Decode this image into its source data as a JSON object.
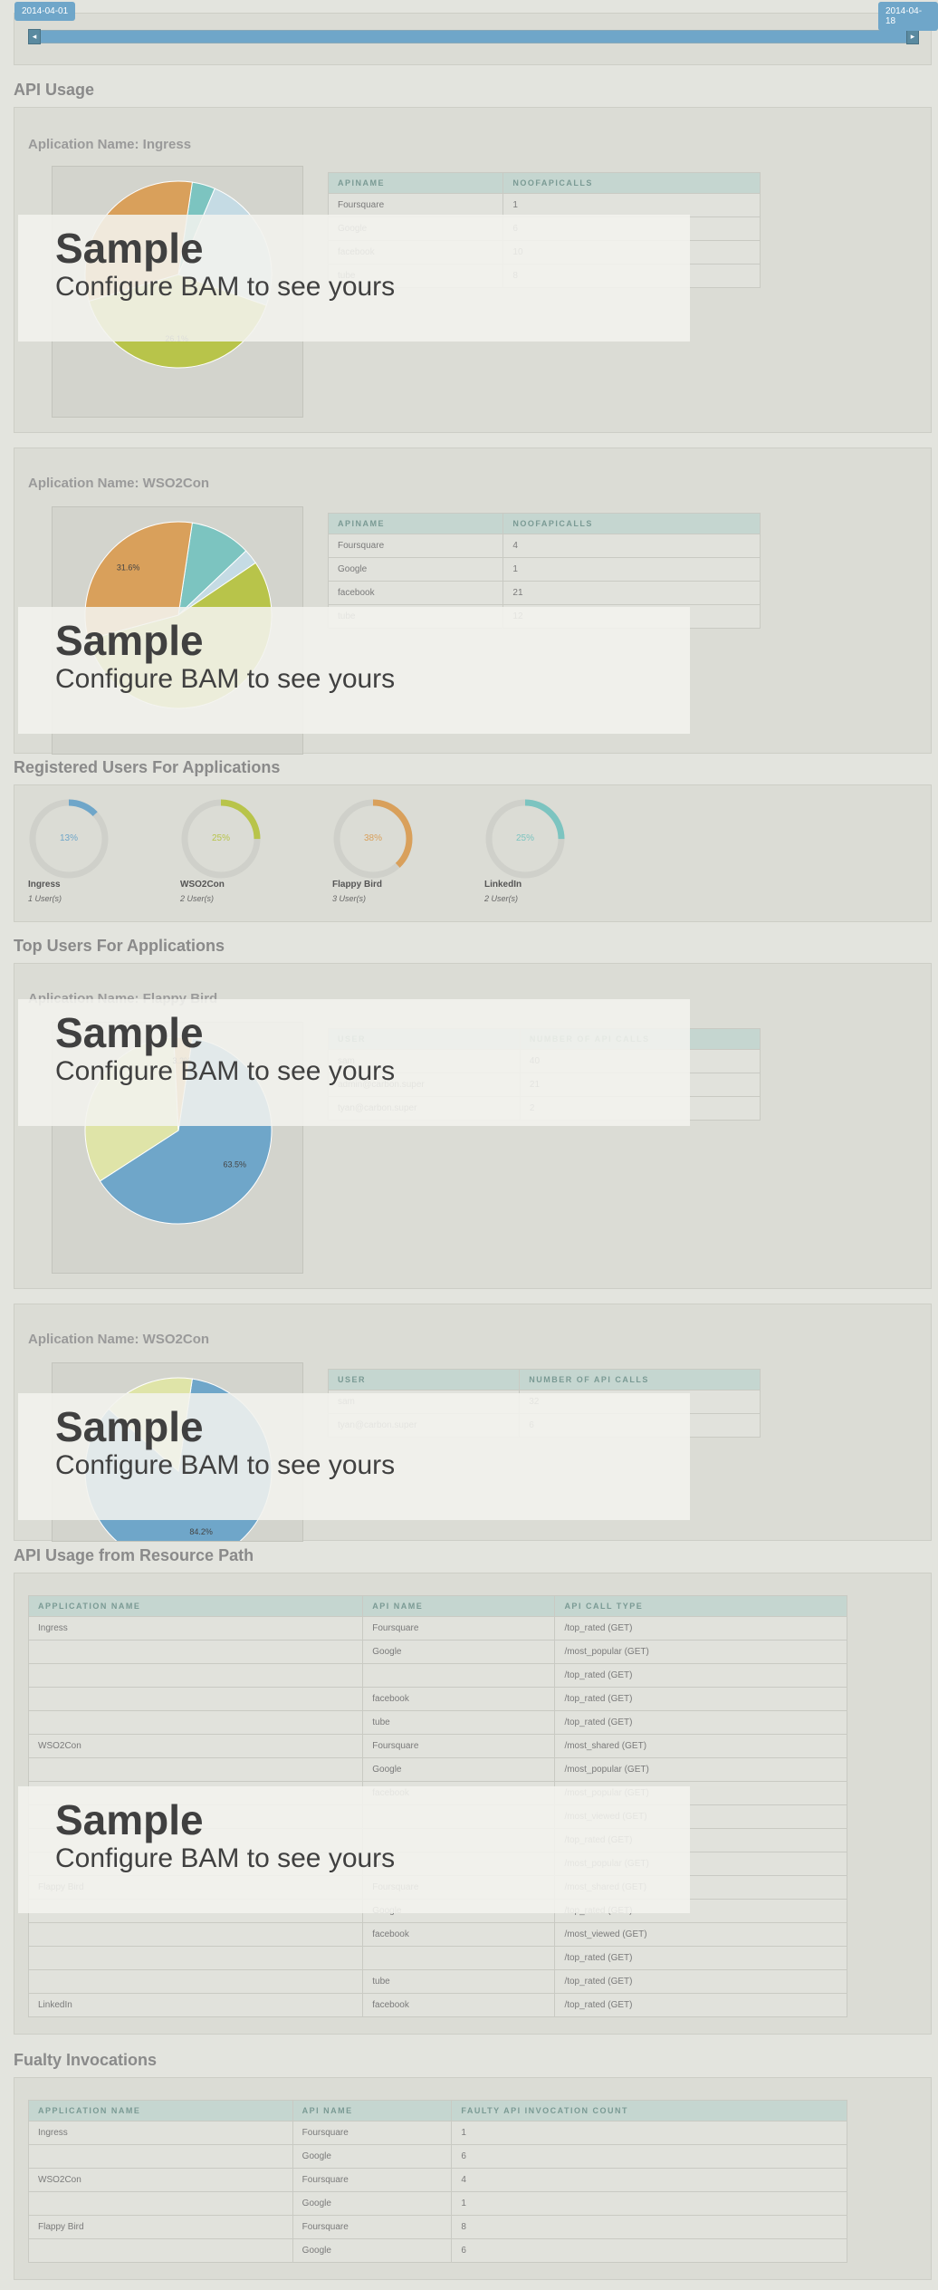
{
  "slider": {
    "start_date": "2014-04-01",
    "end_date": "2014-04-18"
  },
  "sections": {
    "api_usage": "API Usage",
    "registered_users": "Registered Users For Applications",
    "top_users": "Top Users For Applications",
    "resource_path": "API Usage from Resource Path",
    "faulty": "Fualty Invocations"
  },
  "overlay": {
    "line1": "Sample",
    "line2": "Configure BAM to see yours"
  },
  "api_usage": [
    {
      "app": "Aplication Name: Ingress",
      "headers": [
        "APINAME",
        "NOOFAPICALLS"
      ],
      "rows": [
        [
          "Foursquare",
          "1"
        ],
        [
          "Google",
          "6"
        ],
        [
          "facebook",
          "10"
        ],
        [
          "tube",
          "8"
        ]
      ],
      "chart_data": {
        "type": "pie",
        "categories": [
          "Foursquare",
          "Google",
          "facebook",
          "tube"
        ],
        "values": [
          1,
          6,
          10,
          8
        ],
        "labels": [
          "",
          "",
          "26.1%",
          ""
        ]
      }
    },
    {
      "app": "Aplication Name: WSO2Con",
      "headers": [
        "APINAME",
        "NOOFAPICALLS"
      ],
      "rows": [
        [
          "Foursquare",
          "4"
        ],
        [
          "Google",
          "1"
        ],
        [
          "facebook",
          "21"
        ],
        [
          "tube",
          "12"
        ]
      ],
      "chart_data": {
        "type": "pie",
        "categories": [
          "Foursquare",
          "Google",
          "facebook",
          "tube"
        ],
        "values": [
          4,
          1,
          21,
          12
        ],
        "labels": [
          "",
          "",
          "",
          "31.6%"
        ]
      }
    }
  ],
  "registered_users": [
    {
      "name": "Ingress",
      "pct": "13%",
      "value": 13,
      "users": "1 User(s)",
      "color": "#6fa6c9"
    },
    {
      "name": "WSO2Con",
      "pct": "25%",
      "value": 25,
      "users": "2 User(s)",
      "color": "#b8c44a"
    },
    {
      "name": "Flappy Bird",
      "pct": "38%",
      "value": 38,
      "users": "3 User(s)",
      "color": "#d9a05b"
    },
    {
      "name": "LinkedIn",
      "pct": "25%",
      "value": 25,
      "users": "2 User(s)",
      "color": "#7cc4c0"
    }
  ],
  "top_users": [
    {
      "app": "Aplication Name: Flappy Bird",
      "headers": [
        "USER",
        "NUMBER OF API CALLS"
      ],
      "rows": [
        [
          "sam",
          "40"
        ],
        [
          "admin@carbon.super",
          "21"
        ],
        [
          "tyan@carbon.super",
          "2"
        ]
      ],
      "chart_data": {
        "type": "pie",
        "categories": [
          "sam",
          "admin@carbon.super",
          "tyan@carbon.super"
        ],
        "values": [
          40,
          21,
          2
        ],
        "labels": [
          "63.5%",
          "",
          "3.2%"
        ]
      }
    },
    {
      "app": "Aplication Name: WSO2Con",
      "headers": [
        "USER",
        "NUMBER OF API CALLS"
      ],
      "rows": [
        [
          "sam",
          "32"
        ],
        [
          "tyan@carbon.super",
          "6"
        ]
      ],
      "chart_data": {
        "type": "pie",
        "categories": [
          "sam",
          "tyan@carbon.super"
        ],
        "values": [
          32,
          6
        ],
        "labels": [
          "84.2%",
          ""
        ]
      }
    }
  ],
  "resource_path": {
    "headers": [
      "APPLICATION NAME",
      "API NAME",
      "API CALL TYPE"
    ],
    "rows": [
      [
        "Ingress",
        "Foursquare",
        "/top_rated (GET)"
      ],
      [
        "",
        "Google",
        "/most_popular (GET)"
      ],
      [
        "",
        "",
        "/top_rated (GET)"
      ],
      [
        "",
        "facebook",
        "/top_rated (GET)"
      ],
      [
        "",
        "tube",
        "/top_rated (GET)"
      ],
      [
        "WSO2Con",
        "Foursquare",
        "/most_shared (GET)"
      ],
      [
        "",
        "Google",
        "/most_popular (GET)"
      ],
      [
        "",
        "facebook",
        "/most_popular (GET)"
      ],
      [
        "",
        "",
        "/most_viewed (GET)"
      ],
      [
        "",
        "",
        "/top_rated (GET)"
      ],
      [
        "",
        "tube",
        "/most_popular (GET)"
      ],
      [
        "Flappy Bird",
        "Foursquare",
        "/most_shared (GET)"
      ],
      [
        "",
        "Google",
        "/top_rated (GET)"
      ],
      [
        "",
        "facebook",
        "/most_viewed (GET)"
      ],
      [
        "",
        "",
        "/top_rated (GET)"
      ],
      [
        "",
        "tube",
        "/top_rated (GET)"
      ],
      [
        "LinkedIn",
        "facebook",
        "/top_rated (GET)"
      ]
    ]
  },
  "faulty": {
    "headers": [
      "APPLICATION NAME",
      "API NAME",
      "FAULTY API INVOCATION COUNT"
    ],
    "rows": [
      [
        "Ingress",
        "Foursquare",
        "1"
      ],
      [
        "",
        "Google",
        "6"
      ],
      [
        "WSO2Con",
        "Foursquare",
        "4"
      ],
      [
        "",
        "Google",
        "1"
      ],
      [
        "Flappy Bird",
        "Foursquare",
        "8"
      ],
      [
        "",
        "Google",
        "6"
      ]
    ]
  }
}
